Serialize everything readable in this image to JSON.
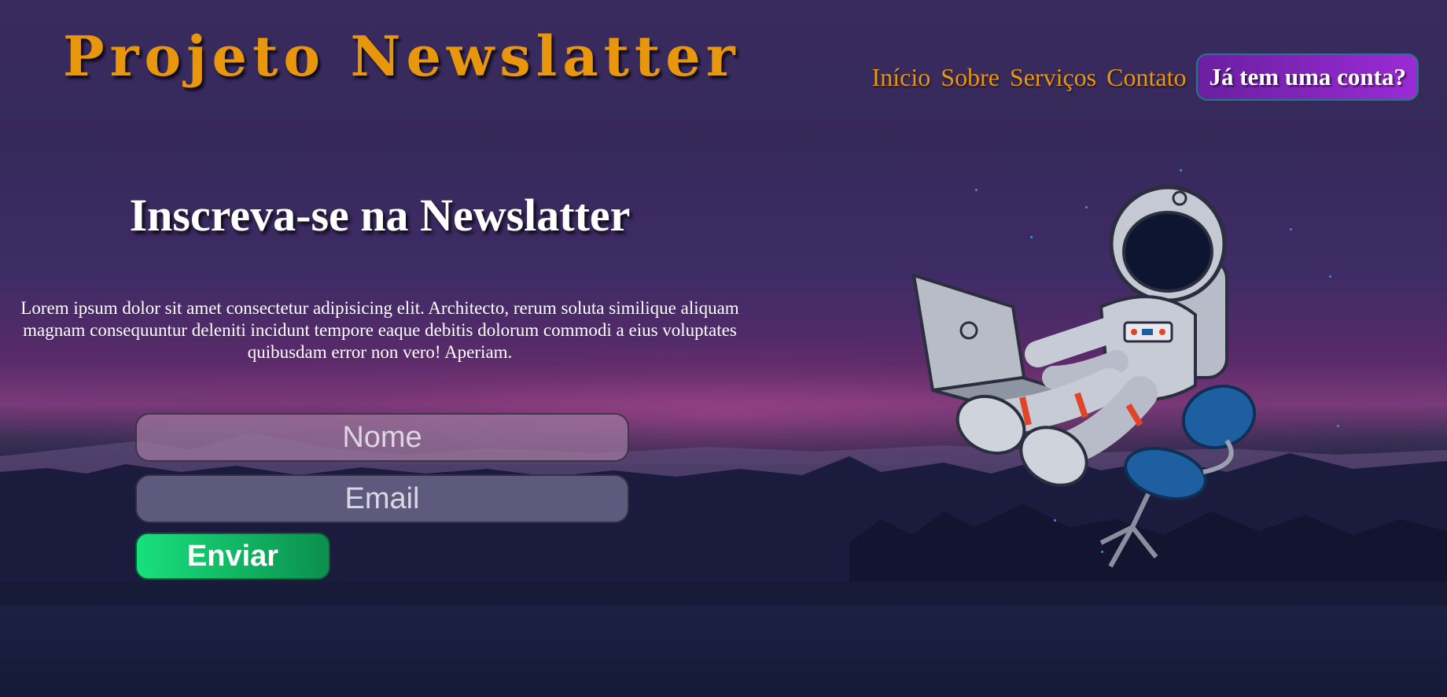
{
  "header": {
    "title": "Projeto Newslatter"
  },
  "nav": {
    "items": [
      {
        "label": "Início"
      },
      {
        "label": "Sobre"
      },
      {
        "label": "Serviços"
      },
      {
        "label": "Contato"
      }
    ],
    "login_label": "Já tem uma conta?"
  },
  "main": {
    "heading": "Inscreva-se na Newslatter",
    "description": "Lorem ipsum dolor sit amet consectetur adipisicing elit. Architecto, rerum soluta similique aliquam magnam consequuntur deleniti incidunt tempore eaque debitis dolorum commodi a eius voluptates quibusdam error non vero! Aperiam."
  },
  "form": {
    "name_placeholder": "Nome",
    "email_placeholder": "Email",
    "submit_label": "Enviar"
  },
  "colors": {
    "accent": "#e8960c",
    "button_purple": "#9b2bd6",
    "button_green": "#19e07e"
  }
}
